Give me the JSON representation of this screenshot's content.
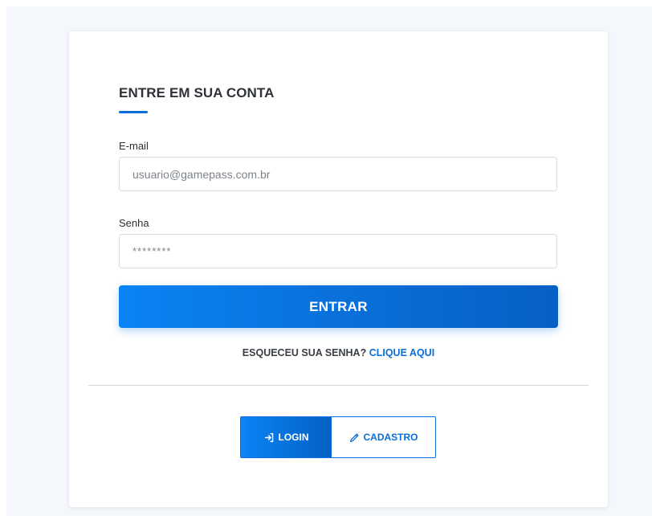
{
  "login_card": {
    "title": "ENTRE EM SUA CONTA",
    "email": {
      "label": "E-mail",
      "placeholder": "usuario@gamepass.com.br"
    },
    "password": {
      "label": "Senha",
      "placeholder": "********"
    },
    "submit_label": "ENTRAR",
    "forgot": {
      "text": "ESQUECEU SUA SENHA?",
      "link": "CLIQUE AQUI"
    },
    "tabs": {
      "login": {
        "label": "LOGIN",
        "icon": "login-icon"
      },
      "cadastro": {
        "label": "CADASTRO",
        "icon": "pencil-icon"
      }
    }
  },
  "colors": {
    "accent": "#0a6fd9",
    "background": "#f4f7fb",
    "text": "#2e3238"
  }
}
